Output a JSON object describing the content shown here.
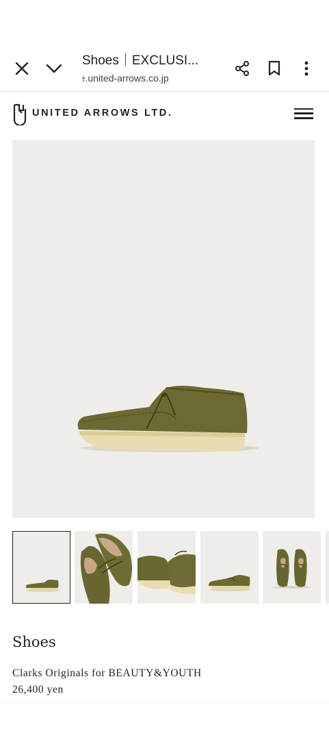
{
  "browser_bar": {
    "title": "Shoes｜EXCLUSI...",
    "url": "re.united-arrows.co.jp",
    "icons": [
      "close-icon",
      "chevron-down-icon",
      "share-icon",
      "bookmark-icon",
      "more-vert-icon"
    ]
  },
  "site_header": {
    "logo_text": "UNITED ARROWS LTD.",
    "icons": [
      "brand-logo-icon",
      "hamburger-menu-icon"
    ]
  },
  "gallery": {
    "thumbnail_count": 6,
    "selected_index": 0
  },
  "product": {
    "category": "Shoes",
    "name": "Clarks Originals for BEAUTY&YOUTH",
    "price": "26,400 yen"
  },
  "colors": {
    "image_background": "#efedea",
    "shoe_suede": "#6b6a32",
    "sole": "#e9dcb2"
  }
}
